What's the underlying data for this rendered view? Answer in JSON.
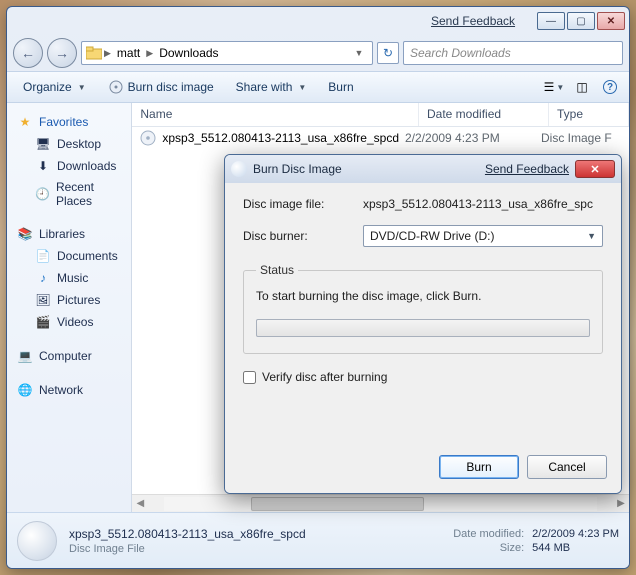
{
  "window": {
    "feedback_label": "Send Feedback",
    "breadcrumb": {
      "seg1": "matt",
      "seg2": "Downloads"
    },
    "search_placeholder": "Search Downloads"
  },
  "toolbar": {
    "organize": "Organize",
    "burn_image": "Burn disc image",
    "share": "Share with",
    "burn": "Burn"
  },
  "columns": {
    "name": "Name",
    "date": "Date modified",
    "type": "Type"
  },
  "files": [
    {
      "name": "xpsp3_5512.080413-2113_usa_x86fre_spcd",
      "date": "2/2/2009 4:23 PM",
      "type": "Disc Image F"
    }
  ],
  "sidebar": {
    "favorites": "Favorites",
    "fav_items": [
      "Desktop",
      "Downloads",
      "Recent Places"
    ],
    "libraries": "Libraries",
    "lib_items": [
      "Documents",
      "Music",
      "Pictures",
      "Videos"
    ],
    "computer": "Computer",
    "network": "Network"
  },
  "details": {
    "filename": "xpsp3_5512.080413-2113_usa_x86fre_spcd",
    "filetype": "Disc Image File",
    "date_lbl": "Date modified:",
    "date_val": "2/2/2009 4:23 PM",
    "size_lbl": "Size:",
    "size_val": "544 MB"
  },
  "dialog": {
    "title": "Burn Disc Image",
    "feedback": "Send Feedback",
    "file_lbl": "Disc image file:",
    "file_val": "xpsp3_5512.080413-2113_usa_x86fre_spc",
    "burner_lbl": "Disc burner:",
    "burner_val": "DVD/CD-RW Drive (D:)",
    "status_legend": "Status",
    "status_text": "To start burning the disc image, click Burn.",
    "verify_lbl": "Verify disc after burning",
    "burn_btn": "Burn",
    "cancel_btn": "Cancel"
  }
}
